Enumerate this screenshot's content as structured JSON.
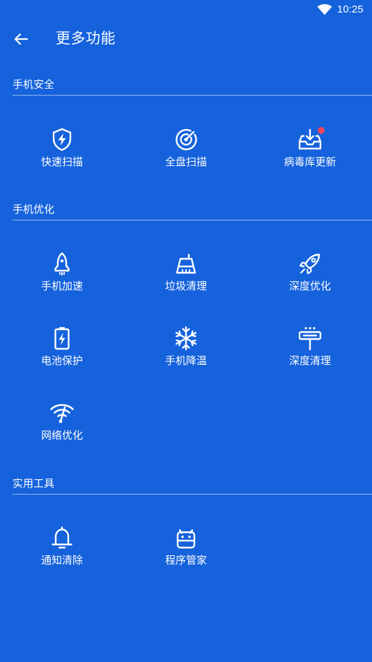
{
  "status_bar": {
    "time": "10:25",
    "wifi_icon": "wifi-icon"
  },
  "header": {
    "back_icon": "arrow-left-icon",
    "title": "更多功能"
  },
  "colors": {
    "background": "#1562DC",
    "foreground": "#FFFFFF",
    "badge": "#F0455A"
  },
  "sections": [
    {
      "title": "手机安全",
      "items": [
        {
          "label": "快速扫描",
          "icon": "shield-lightning-icon"
        },
        {
          "label": "全盘扫描",
          "icon": "radar-target-icon"
        },
        {
          "label": "病毒库更新",
          "icon": "inbox-download-icon",
          "badge": true
        }
      ]
    },
    {
      "title": "手机优化",
      "items": [
        {
          "label": "手机加速",
          "icon": "rocket-icon"
        },
        {
          "label": "垃圾清理",
          "icon": "broom-icon"
        },
        {
          "label": "深度优化",
          "icon": "rocket-launch-icon"
        },
        {
          "label": "电池保护",
          "icon": "battery-charging-icon"
        },
        {
          "label": "手机降温",
          "icon": "snowflake-icon"
        },
        {
          "label": "深度清理",
          "icon": "vacuum-cleaner-icon"
        },
        {
          "label": "网络优化",
          "icon": "wifi-boost-icon"
        }
      ]
    },
    {
      "title": "实用工具",
      "items": [
        {
          "label": "通知清除",
          "icon": "bell-icon"
        },
        {
          "label": "程序管家",
          "icon": "android-robot-icon"
        }
      ]
    }
  ]
}
